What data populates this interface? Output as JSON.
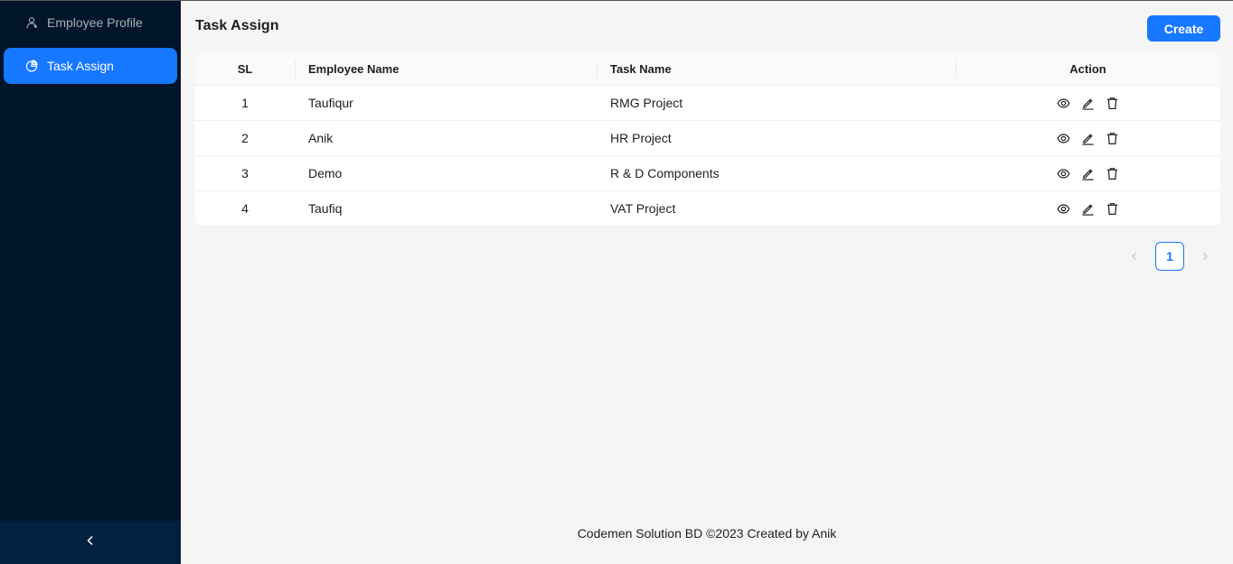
{
  "sidebar": {
    "items": [
      {
        "label": "Employee Profile",
        "icon": "user-icon"
      },
      {
        "label": "Task Assign",
        "icon": "pie-chart-icon",
        "active": true
      }
    ],
    "collapse_icon": "chevron-left-icon"
  },
  "header": {
    "title": "Task Assign",
    "create_label": "Create"
  },
  "table": {
    "columns": [
      "SL",
      "Employee Name",
      "Task Name",
      "Action"
    ],
    "rows": [
      {
        "sl": "1",
        "employee": "Taufiqur",
        "task": "RMG Project"
      },
      {
        "sl": "2",
        "employee": "Anik",
        "task": "HR Project"
      },
      {
        "sl": "3",
        "employee": "Demo",
        "task": "R & D Components"
      },
      {
        "sl": "4",
        "employee": "Taufiq",
        "task": "VAT Project"
      }
    ],
    "action_icons": [
      "eye-icon",
      "edit-icon",
      "delete-icon"
    ]
  },
  "pagination": {
    "current_page": "1"
  },
  "footer": {
    "text": "Codemen Solution BD ©2023 Created by Anik"
  },
  "colors": {
    "primary": "#1677ff",
    "sidebar_bg": "#001529",
    "collapse_bg": "#002140",
    "page_bg": "#f5f5f5"
  }
}
